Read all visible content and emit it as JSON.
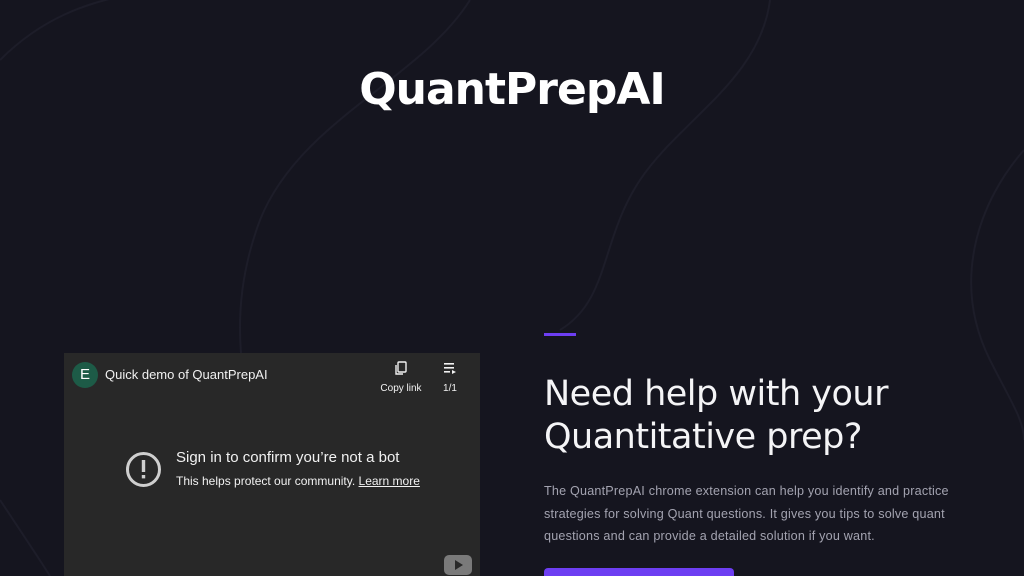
{
  "site": {
    "title": "QuantPrepAI"
  },
  "video": {
    "avatar_letter": "E",
    "title": "Quick demo of QuantPrepAI",
    "copy_link_label": "Copy link",
    "playlist_count": "1/1",
    "error_title": "Sign in to confirm you’re not a bot",
    "error_sub": "This helps protect our community.",
    "learn_more": "Learn more"
  },
  "hero": {
    "headline_line1": "Need help with your",
    "headline_line2": "Quantitative prep?",
    "description": "The QuantPrepAI chrome extension can help you identify and practice strategies for solving Quant questions. It gives you tips to solve quant questions and can provide a detailed solution if you want."
  },
  "colors": {
    "background": "#15151f",
    "accent": "#6d3ef2",
    "video_bg": "#282828",
    "avatar": "#1d5b47"
  },
  "icons": [
    "copy-icon",
    "playlist-icon",
    "warning-icon",
    "youtube-icon"
  ]
}
